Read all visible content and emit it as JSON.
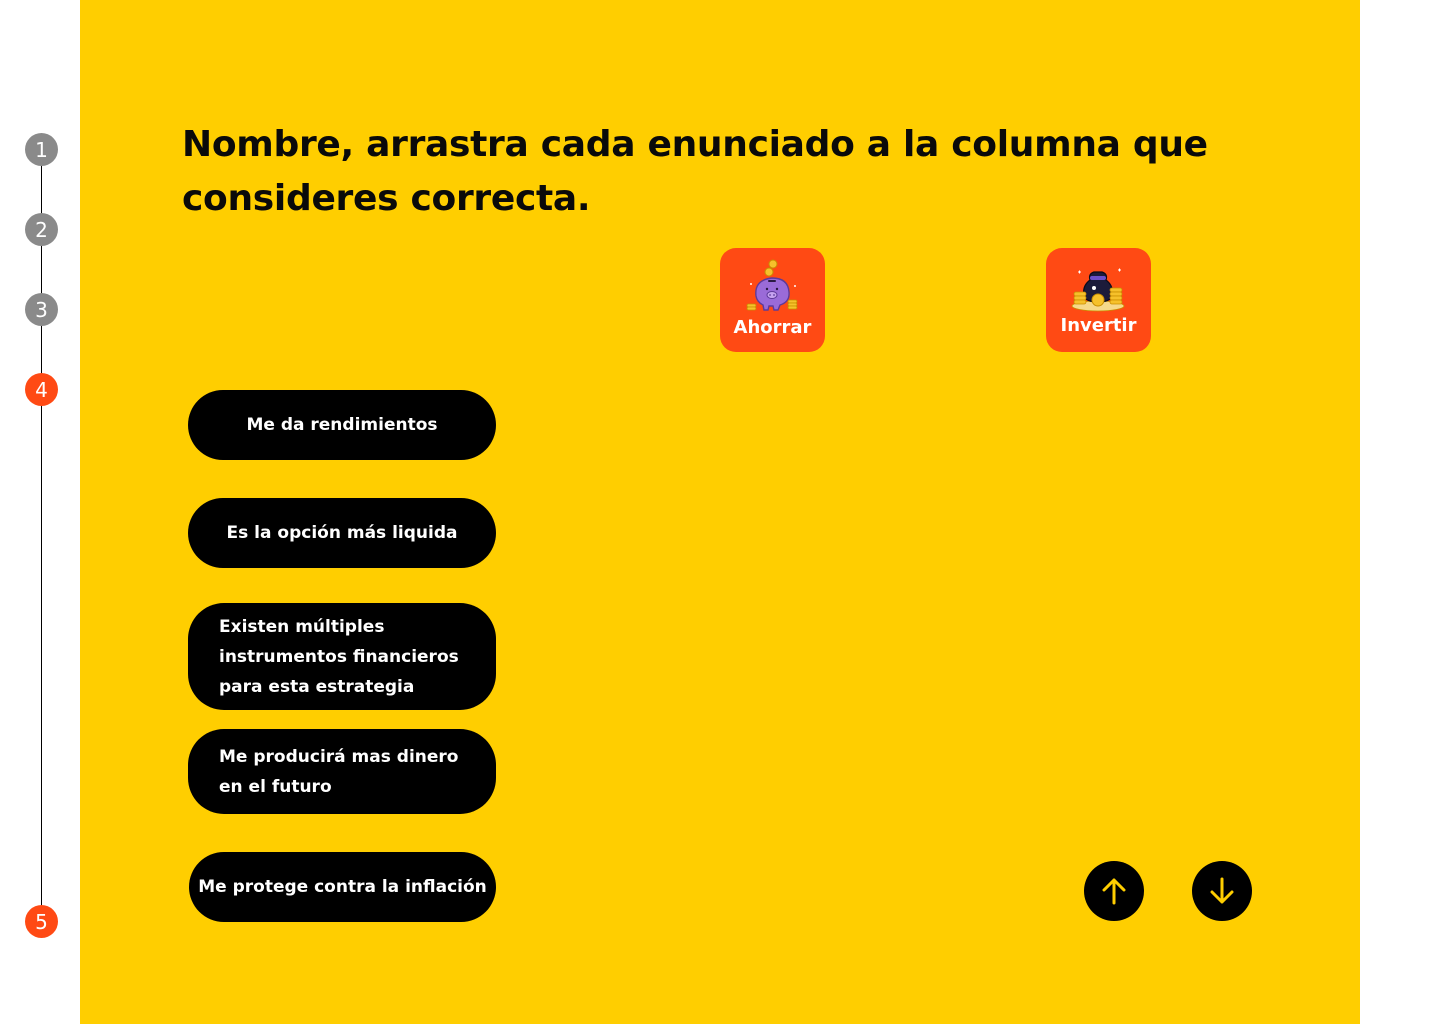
{
  "progress": {
    "steps": [
      {
        "label": "1",
        "state": "done"
      },
      {
        "label": "2",
        "state": "done"
      },
      {
        "label": "3",
        "state": "done"
      },
      {
        "label": "4",
        "state": "active"
      },
      {
        "label": "5",
        "state": "active"
      }
    ]
  },
  "question": {
    "title": "Nombre, arrastra cada enunciado a la columna que consideres correcta."
  },
  "columns": [
    {
      "label": "Ahorrar",
      "icon": "piggy-bank-icon"
    },
    {
      "label": "Invertir",
      "icon": "money-bag-coins-icon"
    }
  ],
  "statements": [
    "Me da rendimientos",
    "Es la opción más liquida",
    "Existen múltiples instrumentos financieros para esta estrategia",
    "Me producirá mas dinero en el futuro",
    "Me protege contra la inflación"
  ],
  "navigation": {
    "up_icon": "arrow-up-icon",
    "down_icon": "arrow-down-icon"
  },
  "colors": {
    "background": "#FFCE00",
    "accent": "#FF4A14",
    "step_done": "#8A8A8A",
    "chip": "#000000",
    "nav_arrow": "#FFCE00"
  }
}
